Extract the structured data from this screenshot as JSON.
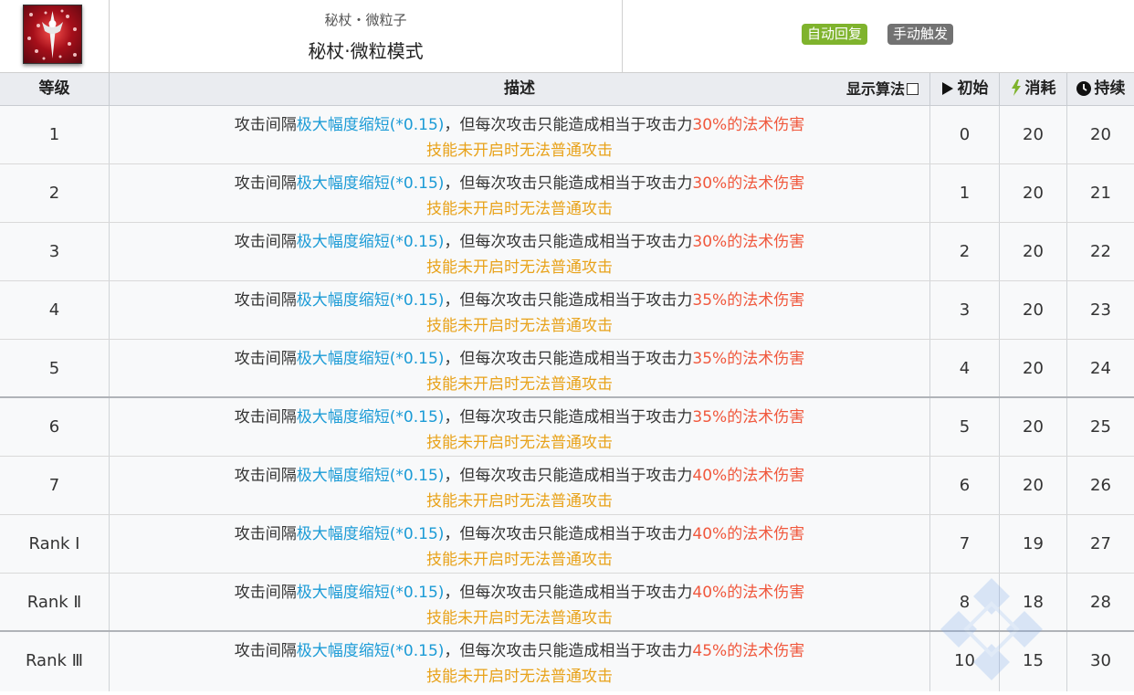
{
  "skill": {
    "subtitle": "秘杖・微粒子",
    "name": "秘杖·微粒模式",
    "tags": [
      "自动回复",
      "手动触发"
    ],
    "icon": "skill-icon"
  },
  "table": {
    "headers": {
      "level": "等级",
      "description": "描述",
      "show_formula": "显示算法",
      "initial": "初始",
      "cost": "消耗",
      "duration": "持续"
    },
    "rows": [
      {
        "level": "1",
        "d1": "攻击间隔",
        "d2": "极大幅度缩短(*0.15)",
        "d3": "，但每次攻击只能造成相当于攻击力",
        "d4": "30%的法术伤害",
        "d5": "技能未开启时无法普通攻击",
        "initial": "0",
        "cost": "20",
        "duration": "20"
      },
      {
        "level": "2",
        "d1": "攻击间隔",
        "d2": "极大幅度缩短(*0.15)",
        "d3": "，但每次攻击只能造成相当于攻击力",
        "d4": "30%的法术伤害",
        "d5": "技能未开启时无法普通攻击",
        "initial": "1",
        "cost": "20",
        "duration": "21"
      },
      {
        "level": "3",
        "d1": "攻击间隔",
        "d2": "极大幅度缩短(*0.15)",
        "d3": "，但每次攻击只能造成相当于攻击力",
        "d4": "30%的法术伤害",
        "d5": "技能未开启时无法普通攻击",
        "initial": "2",
        "cost": "20",
        "duration": "22"
      },
      {
        "level": "4",
        "d1": "攻击间隔",
        "d2": "极大幅度缩短(*0.15)",
        "d3": "，但每次攻击只能造成相当于攻击力",
        "d4": "35%的法术伤害",
        "d5": "技能未开启时无法普通攻击",
        "initial": "3",
        "cost": "20",
        "duration": "23"
      },
      {
        "level": "5",
        "d1": "攻击间隔",
        "d2": "极大幅度缩短(*0.15)",
        "d3": "，但每次攻击只能造成相当于攻击力",
        "d4": "35%的法术伤害",
        "d5": "技能未开启时无法普通攻击",
        "initial": "4",
        "cost": "20",
        "duration": "24"
      },
      {
        "level": "6",
        "d1": "攻击间隔",
        "d2": "极大幅度缩短(*0.15)",
        "d3": "，但每次攻击只能造成相当于攻击力",
        "d4": "35%的法术伤害",
        "d5": "技能未开启时无法普通攻击",
        "initial": "5",
        "cost": "20",
        "duration": "25"
      },
      {
        "level": "7",
        "d1": "攻击间隔",
        "d2": "极大幅度缩短(*0.15)",
        "d3": "，但每次攻击只能造成相当于攻击力",
        "d4": "40%的法术伤害",
        "d5": "技能未开启时无法普通攻击",
        "initial": "6",
        "cost": "20",
        "duration": "26"
      },
      {
        "level": "Rank Ⅰ",
        "d1": "攻击间隔",
        "d2": "极大幅度缩短(*0.15)",
        "d3": "，但每次攻击只能造成相当于攻击力",
        "d4": "40%的法术伤害",
        "d5": "技能未开启时无法普通攻击",
        "initial": "7",
        "cost": "19",
        "duration": "27"
      },
      {
        "level": "Rank Ⅱ",
        "d1": "攻击间隔",
        "d2": "极大幅度缩短(*0.15)",
        "d3": "，但每次攻击只能造成相当于攻击力",
        "d4": "40%的法术伤害",
        "d5": "技能未开启时无法普通攻击",
        "initial": "8",
        "cost": "18",
        "duration": "28"
      },
      {
        "level": "Rank Ⅲ",
        "d1": "攻击间隔",
        "d2": "极大幅度缩短(*0.15)",
        "d3": "，但每次攻击只能造成相当于攻击力",
        "d4": "45%的法术伤害",
        "d5": "技能未开启时无法普通攻击",
        "initial": "10",
        "cost": "15",
        "duration": "30"
      }
    ]
  },
  "colors": {
    "auto_recover": "#7fb32d",
    "manual_trigger": "#727272",
    "highlight_blue": "#1b9bd6",
    "highlight_red": "#f0573c",
    "note_orange": "#e8a21a"
  }
}
